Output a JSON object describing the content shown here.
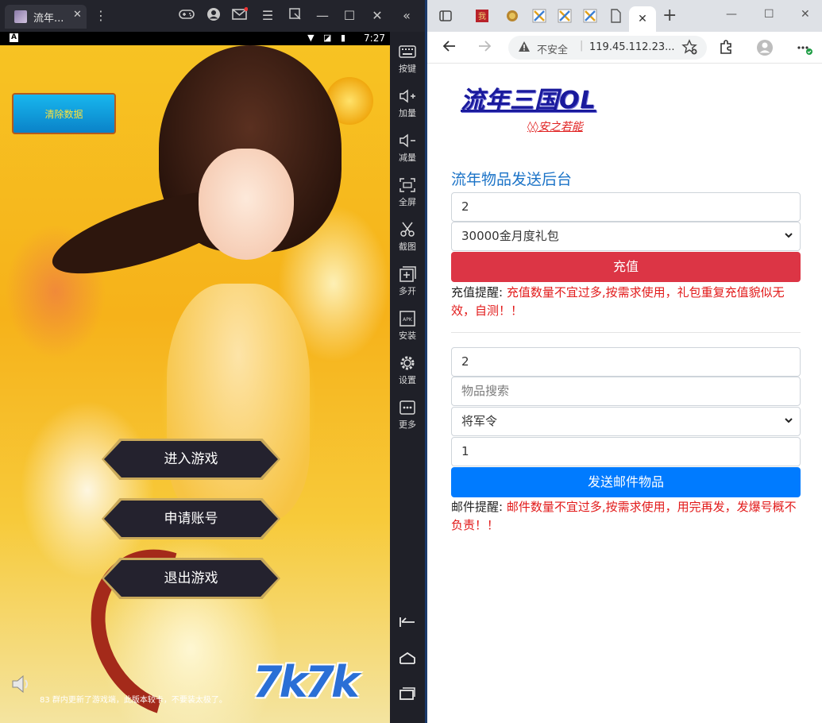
{
  "emulator": {
    "tab_title": "流年...",
    "tab_close": "✕",
    "statusbar": {
      "badge": "A",
      "time": "7:27"
    },
    "game": {
      "clear_button": "清除数据",
      "menu": [
        "进入游戏",
        "申请账号",
        "退出游戏"
      ],
      "logo": "7k7k",
      "marquee": "83 群内更新了游戏端，此版本较卡，不要装太极了。"
    },
    "sidebar": [
      {
        "label": "按键",
        "icon": "keyboard-icon"
      },
      {
        "label": "加量",
        "icon": "volume-up-icon"
      },
      {
        "label": "减量",
        "icon": "volume-down-icon"
      },
      {
        "label": "全屏",
        "icon": "fullscreen-icon"
      },
      {
        "label": "截图",
        "icon": "scissors-icon"
      },
      {
        "label": "多开",
        "icon": "multi-instance-icon"
      },
      {
        "label": "安装",
        "icon": "apk-install-icon"
      },
      {
        "label": "设置",
        "icon": "gear-icon"
      },
      {
        "label": "更多",
        "icon": "more-icon"
      }
    ]
  },
  "browser": {
    "active_tab_close": "✕",
    "new_tab": "+",
    "omnibox": {
      "security_label": "不安全",
      "url": "119.45.112.23..."
    }
  },
  "page": {
    "logo": "流年三国OL",
    "subtitle": "◊◊安之若能",
    "section_title": "流年物品发送后台",
    "recharge": {
      "id_value": "2",
      "package_selected": "30000金月度礼包",
      "button": "充值",
      "notice_label": "充值提醒:",
      "notice_text": "充值数量不宜过多,按需求使用，礼包重复充值貌似无效，自测！！"
    },
    "mail": {
      "id_value": "2",
      "search_placeholder": "物品搜索",
      "item_selected": "将军令",
      "quantity_value": "1",
      "button": "发送邮件物品",
      "notice_label": "邮件提醒:",
      "notice_text": "邮件数量不宜过多,按需求使用，用完再发，发爆号概不负责！！"
    }
  },
  "colors": {
    "recharge_button": "#dc3545",
    "mail_button": "#007bff",
    "notice_red": "#e21a1a",
    "section_title": "#1b73c7"
  }
}
